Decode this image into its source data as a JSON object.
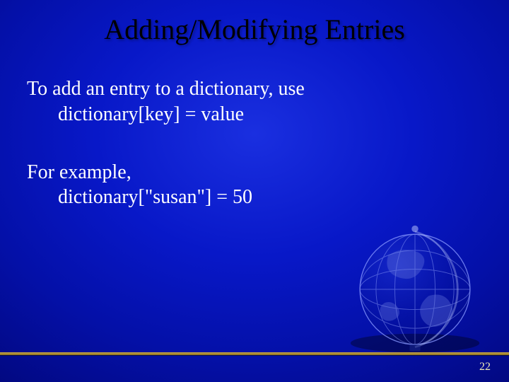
{
  "title": "Adding/Modifying Entries",
  "body": {
    "line1": "To add an entry to a dictionary, use",
    "line2": "dictionary[key] = value",
    "line3": "For example,",
    "line4": "dictionary[\"susan\"] = 50"
  },
  "page_number": "22"
}
